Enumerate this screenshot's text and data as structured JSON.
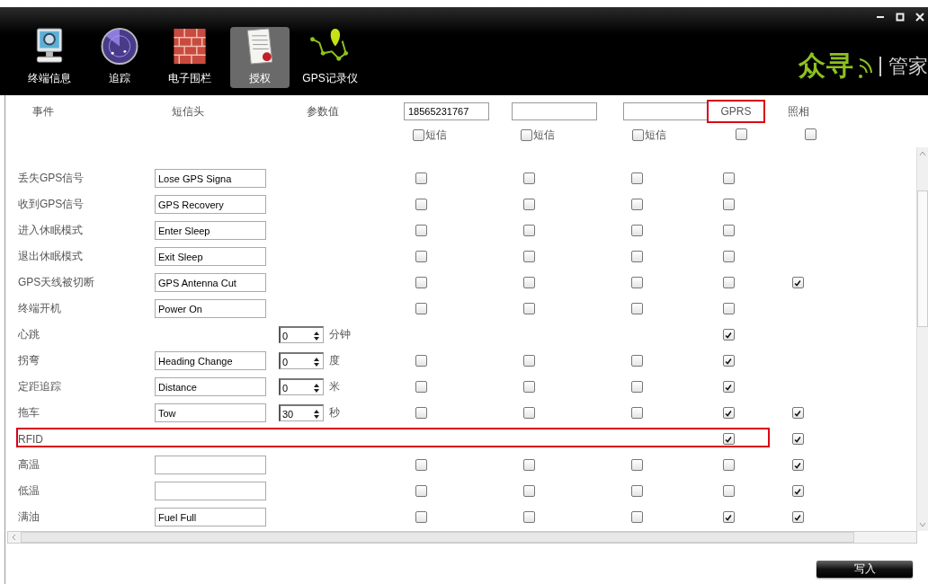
{
  "toolbar": {
    "items": [
      {
        "label": "终端信息",
        "selected": false
      },
      {
        "label": "追踪",
        "selected": false
      },
      {
        "label": "电子围栏",
        "selected": false
      },
      {
        "label": "授权",
        "selected": true
      },
      {
        "label": "GPS记录仪",
        "selected": false
      }
    ],
    "logo": {
      "brand": "众寻",
      "suffix": "管家"
    }
  },
  "columns": {
    "event": "事件",
    "sms_header": "短信头",
    "param": "参数值",
    "recipients": [
      {
        "number": "18565231767",
        "sms_label": "短信",
        "sms": false
      },
      {
        "sms_label": "短信",
        "sms": false
      },
      {
        "sms_label": "短信",
        "sms": false
      }
    ],
    "gprs": {
      "label": "GPRS",
      "highlighted": true,
      "checked": false
    },
    "photo": {
      "label": "照相",
      "checked": false
    }
  },
  "rows": [
    {
      "kind": "event",
      "event": "丢失GPS信号",
      "sms_header": "Lose GPS Signa",
      "sms": [
        false,
        false,
        false
      ],
      "gprs": false,
      "highlighted": false
    },
    {
      "kind": "event",
      "event": "收到GPS信号",
      "sms_header": "GPS Recovery",
      "sms": [
        false,
        false,
        false
      ],
      "gprs": false,
      "highlighted": false
    },
    {
      "kind": "event",
      "event": "进入休眠模式",
      "sms_header": "Enter Sleep",
      "sms": [
        false,
        false,
        false
      ],
      "gprs": false,
      "highlighted": false
    },
    {
      "kind": "event",
      "event": "退出休眠模式",
      "sms_header": "Exit Sleep",
      "sms": [
        false,
        false,
        false
      ],
      "gprs": false,
      "highlighted": false
    },
    {
      "kind": "event",
      "event": "GPS天线被切断",
      "sms_header": "GPS Antenna Cut",
      "sms": [
        false,
        false,
        false
      ],
      "gprs": false,
      "photo": true,
      "highlighted": false
    },
    {
      "kind": "event",
      "event": "终端开机",
      "sms_header": "Power On",
      "sms": [
        false,
        false,
        false
      ],
      "gprs": false,
      "highlighted": false
    },
    {
      "kind": "heartbeat",
      "event": "心跳",
      "param": {
        "value": "0",
        "unit": "分钟"
      },
      "gprs": true,
      "highlighted": false
    },
    {
      "kind": "event",
      "event": "拐弯",
      "sms_header": "Heading Change",
      "param": {
        "value": "0",
        "unit": "度"
      },
      "sms": [
        false,
        false,
        false
      ],
      "gprs": true,
      "highlighted": false
    },
    {
      "kind": "event",
      "event": "定距追踪",
      "sms_header": "Distance",
      "param": {
        "value": "0",
        "unit": "米"
      },
      "sms": [
        false,
        false,
        false
      ],
      "gprs": true,
      "highlighted": false
    },
    {
      "kind": "event",
      "event": "拖车",
      "sms_header": "Tow",
      "param": {
        "value": "30",
        "unit": "秒"
      },
      "sms": [
        false,
        false,
        false
      ],
      "gprs": true,
      "photo": true,
      "highlighted": false
    },
    {
      "kind": "flag",
      "event": "RFID",
      "gprs": true,
      "photo": true,
      "highlighted": true
    },
    {
      "kind": "event",
      "event": "高温",
      "sms": [
        false,
        false,
        false
      ],
      "gprs": false,
      "photo": true,
      "highlighted": false
    },
    {
      "kind": "event",
      "event": "低温",
      "sms": [
        false,
        false,
        false
      ],
      "gprs": false,
      "photo": true,
      "highlighted": false
    },
    {
      "kind": "event",
      "event": "满油",
      "sms_header": "Fuel Full",
      "sms": [
        false,
        false,
        false
      ],
      "gprs": true,
      "photo": true,
      "highlighted": false
    }
  ],
  "write_button": "写入"
}
